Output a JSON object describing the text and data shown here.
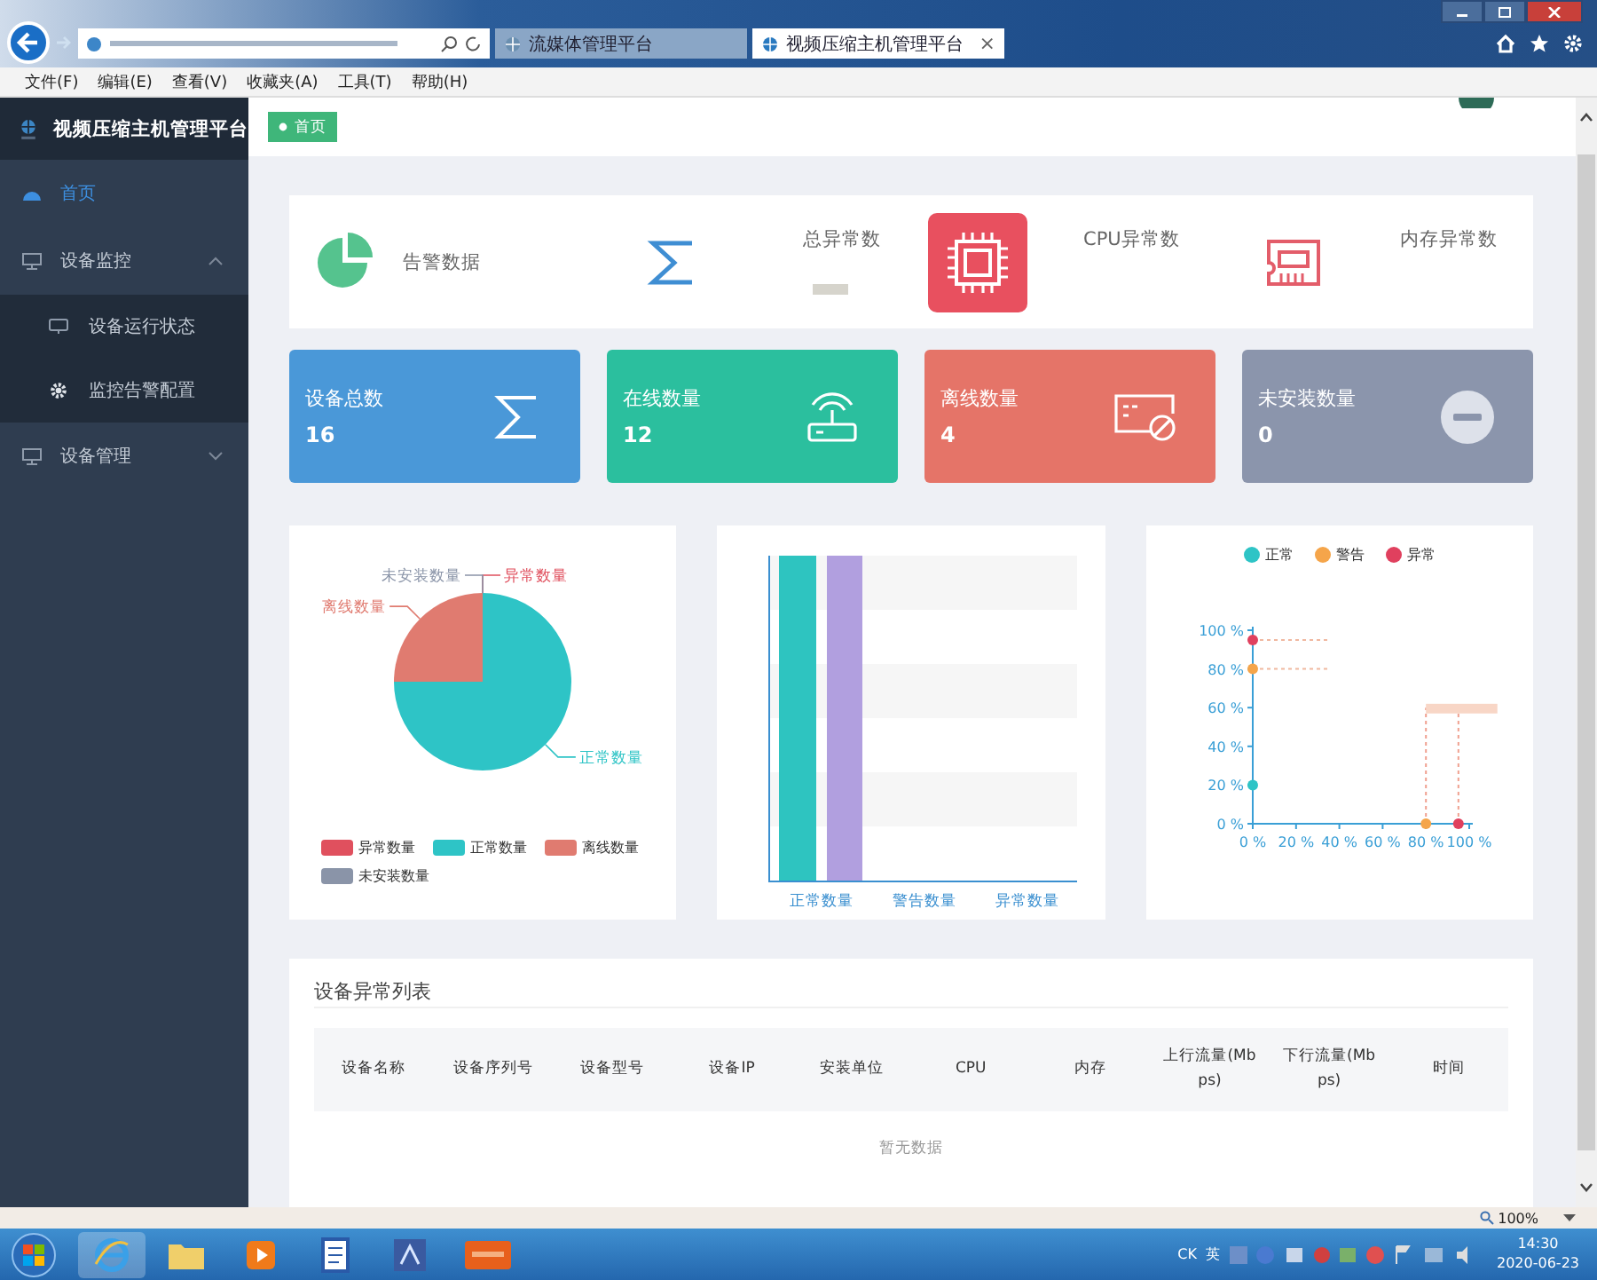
{
  "browser": {
    "tabs": [
      {
        "label": "流媒体管理平台",
        "selected": false
      },
      {
        "label": "视频压缩主机管理平台",
        "selected": true,
        "close": "×"
      }
    ]
  },
  "menu": [
    "文件(F)",
    "编辑(E)",
    "查看(V)",
    "收藏夹(A)",
    "工具(T)",
    "帮助(H)"
  ],
  "app_title": "视频压缩主机管理平台",
  "breadcrumb": {
    "label": "首页"
  },
  "sidebar": {
    "items": [
      {
        "label": "首页",
        "selected": true
      },
      {
        "label": "设备监控",
        "selected": false,
        "expanded": true,
        "children": [
          {
            "label": "设备运行状态",
            "selected": false
          },
          {
            "label": "监控告警配置",
            "selected": false
          }
        ]
      },
      {
        "label": "设备管理",
        "selected": false,
        "expanded": false
      }
    ]
  },
  "summary": [
    {
      "label": "告警数据"
    },
    {
      "label": "总异常数"
    },
    {
      "label": "CPU异常数"
    },
    {
      "label": "内存异常数"
    }
  ],
  "stats": [
    {
      "label": "设备总数",
      "value": "16",
      "color": "#4a98d8"
    },
    {
      "label": "在线数量",
      "value": "12",
      "color": "#2bbf9e"
    },
    {
      "label": "离线数量",
      "value": "4",
      "color": "#e57468"
    },
    {
      "label": "未安装数量",
      "value": "0",
      "color": "#8b95ac"
    }
  ],
  "pie_panel": {
    "chart_data": {
      "type": "pie",
      "categories": [
        "异常数量",
        "正常数量",
        "离线数量",
        "未安装数量"
      ],
      "values": [
        0,
        75,
        25,
        0
      ]
    },
    "legend": [
      {
        "label": "异常数量",
        "color": "#e0505e"
      },
      {
        "label": "正常数量",
        "color": "#2ec4c6"
      },
      {
        "label": "离线数量",
        "color": "#e07b70"
      },
      {
        "label": "未安装数量",
        "color": "#8a94a8"
      }
    ]
  },
  "bar_panel": {
    "categories": [
      "正常数量",
      "警告数量",
      "异常数量"
    ]
  },
  "scatter_panel": {
    "chart_data": {
      "type": "scatter",
      "xlim": [
        0,
        100
      ],
      "ylim": [
        0,
        100
      ],
      "xticks": [
        {
          "value": 0,
          "label": "0 %"
        },
        {
          "value": 20,
          "label": "20 %"
        },
        {
          "value": 40,
          "label": "40 %"
        },
        {
          "value": 60,
          "label": "60 %"
        },
        {
          "value": 80,
          "label": "80 %"
        },
        {
          "value": 100,
          "label": "100 %"
        }
      ],
      "yticks": [
        {
          "value": 0,
          "label": "0 %"
        },
        {
          "value": 20,
          "label": "20 %"
        },
        {
          "value": 40,
          "label": "40 %"
        },
        {
          "value": 60,
          "label": "60 %"
        },
        {
          "value": 80,
          "label": "80 %"
        },
        {
          "value": 100,
          "label": "100 %"
        }
      ],
      "x": [
        0,
        80,
        95
      ],
      "series": [
        {
          "name": "正常",
          "color": "#2ec4c6",
          "values": [
            20,
            null,
            null
          ]
        },
        {
          "name": "警告",
          "color": "#f5a54a",
          "values": [
            80,
            0,
            null
          ]
        },
        {
          "name": "异常",
          "color": "#e0405e",
          "values": [
            95,
            null,
            0
          ]
        }
      ],
      "ref_lines": [
        {
          "axis": "y",
          "value": 95,
          "color": "#f0b8a0"
        },
        {
          "axis": "y",
          "value": 80,
          "color": "#f0b8a0"
        },
        {
          "axis": "x",
          "value": 80,
          "color": "#f0a090"
        },
        {
          "axis": "x",
          "value": 95,
          "color": "#f0a090"
        }
      ],
      "bands": [
        {
          "axis": "y",
          "from": 57,
          "to": 62,
          "color": "#f8d6c6"
        }
      ]
    }
  },
  "table": {
    "title": "设备异常列表",
    "columns": [
      "设备名称",
      "设备序列号",
      "设备型号",
      "设备IP",
      "安装单位",
      "CPU",
      "内存",
      "上行流量(Mbps)",
      "下行流量(Mbps)",
      "时间"
    ],
    "empty_text": "暂无数据"
  },
  "status_bar": {
    "zoom": "100%"
  },
  "taskbar": {
    "tray": [
      "CK",
      "英"
    ],
    "time": "14:30",
    "date": "2020-06-23"
  }
}
